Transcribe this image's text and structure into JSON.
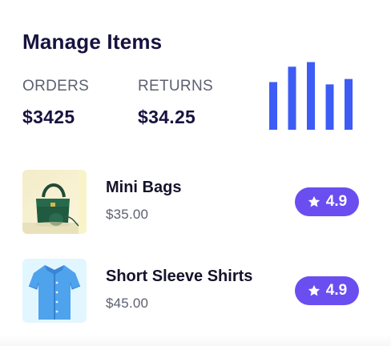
{
  "page": {
    "title": "Manage Items"
  },
  "stats": {
    "orders": {
      "label": "ORDERS",
      "value": "$3425"
    },
    "returns": {
      "label": "RETURNS",
      "value": "$34.25"
    }
  },
  "chart_data": {
    "type": "bar",
    "values": [
      62,
      82,
      88,
      59,
      66
    ],
    "ylim": [
      0,
      100
    ],
    "color": "#3d5cf5"
  },
  "items": [
    {
      "name": "Mini Bags",
      "price": "$35.00",
      "rating": "4.9",
      "image_icon": "handbag-photo"
    },
    {
      "name": "Short Sleeve Shirts",
      "price": "$45.00",
      "rating": "4.9",
      "image_icon": "shirt-photo"
    }
  ],
  "colors": {
    "heading": "#17123f",
    "muted": "#5d6070",
    "rating_badge": "#6b4ef0",
    "bar": "#3d5cf5"
  }
}
